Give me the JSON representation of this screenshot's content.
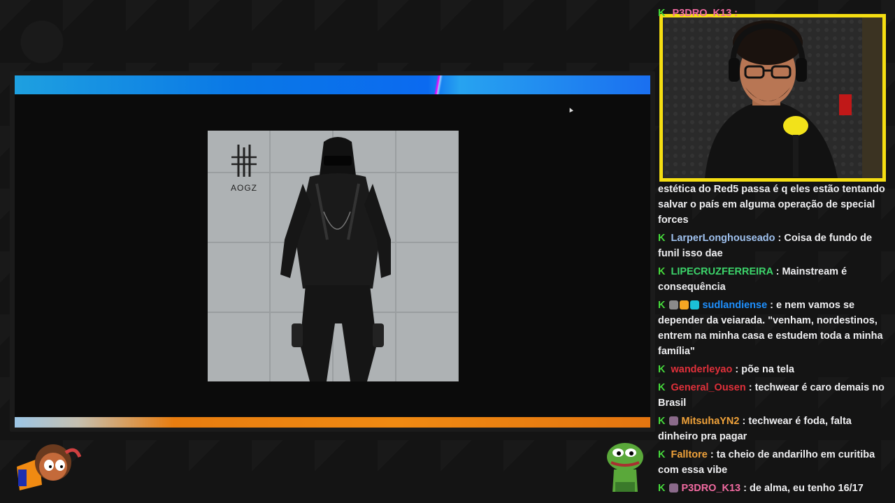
{
  "photo": {
    "logo_text": "AOGZ"
  },
  "chat": {
    "top_user": "P3DRO_K13 :",
    "continued_text": "estética do Red5 passa é q eles estão tentando salvar o país em alguma operação de special forces",
    "messages": [
      {
        "user": "LarperLonghouseado",
        "color": "#9fc1ee",
        "text": "Coisa de fundo de funil isso dae",
        "badges": []
      },
      {
        "user": "LIPECRUZFERREIRA",
        "color": "#3cd46a",
        "text": "Mainstream é consequência",
        "badges": []
      },
      {
        "user": "sudlandiense",
        "color": "#1e90ff",
        "text": "e nem vamos se depender da veiarada. \"venham, nordestinos, entrem na minha casa e estudem toda a minha família\"",
        "badges": [
          "#8a8a8a",
          "#f5a623",
          "#1bc0d8"
        ]
      },
      {
        "user": "wanderleyao",
        "color": "#e0303a",
        "text": "põe na tela",
        "badges": []
      },
      {
        "user": "General_Ousen",
        "color": "#e0303a",
        "text": "techwear é caro demais no Brasil",
        "badges": []
      },
      {
        "user": "MitsuhaYN2",
        "color": "#f0a23a",
        "text": "techwear é foda, falta dinheiro pra pagar",
        "badges": [
          "#8a6a8a"
        ]
      },
      {
        "user": "Falltore",
        "color": "#f0a23a",
        "text": "ta cheio de andarilho em curitiba com essa vibe",
        "badges": []
      },
      {
        "user": "P3DRO_K13",
        "color": "#f06aa0",
        "text": "de alma, eu tenho 16/17",
        "badges": [
          "#8a6a8a"
        ]
      }
    ],
    "badge_letter": "K"
  }
}
